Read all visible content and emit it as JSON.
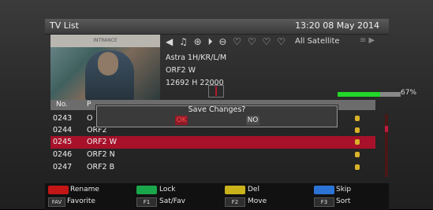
{
  "header": {
    "title": "TV List",
    "datetime": "13:20 08 May 2014"
  },
  "preview": {
    "banner_text": "INTRANCE"
  },
  "icons": [
    "back-arrow-icon",
    "music-note-icon",
    "film-reel-icon",
    "play-circle-icon",
    "minus-circle-icon",
    "heart-icon",
    "heart-icon",
    "heart-icon",
    "heart-icon"
  ],
  "satellite": {
    "label": "All Satellite"
  },
  "channel_info": {
    "satellite": "Astra 1H/KR/L/M",
    "name": "ORF2 W",
    "transponder": "12692 H 22000"
  },
  "signal": {
    "percent_label": "67%",
    "level": 0.67,
    "color": "#22d72a"
  },
  "table": {
    "col_no": "No.",
    "col_name": "P"
  },
  "rows": [
    {
      "no": "0243",
      "name": "O",
      "selected": false
    },
    {
      "no": "0244",
      "name": "ORF2",
      "selected": false
    },
    {
      "no": "0245",
      "name": "ORF2 W",
      "selected": true
    },
    {
      "no": "0246",
      "name": "ORF2 N",
      "selected": false
    },
    {
      "no": "0247",
      "name": "ORF2 B",
      "selected": false
    }
  ],
  "dialog": {
    "question": "Save Changes?",
    "ok": "OK",
    "no": "NO"
  },
  "footer": {
    "rename": "Rename",
    "lock": "Lock",
    "del": "Del",
    "skip": "Skip",
    "fav_key": "FAV",
    "favorite": "Favorite",
    "f1_key": "F1",
    "satfav": "Sat/Fav",
    "f2_key": "F2",
    "move": "Move",
    "f3_key": "F3",
    "sort": "Sort"
  },
  "colors": {
    "red": "#c41616",
    "green": "#1aa64a",
    "yellow": "#c9b21a",
    "blue": "#2b74d6",
    "selected": "#a7112a"
  }
}
